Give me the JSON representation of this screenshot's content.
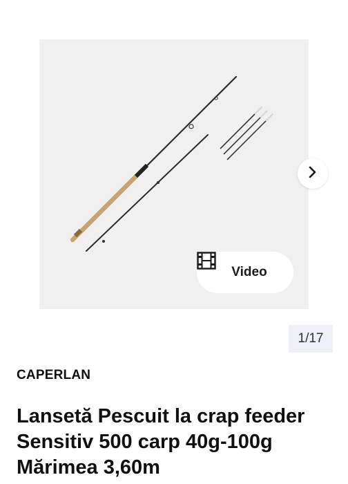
{
  "gallery": {
    "counter": "1/17",
    "video_label": "Video",
    "icons": {
      "video": "film-icon",
      "next": "chevron-right-icon"
    }
  },
  "product": {
    "brand": "CAPERLAN",
    "title": "Lansetă Pescuit la crap feeder Sensitiv 500 carp 40g-100g Mărimea 3,60m"
  }
}
